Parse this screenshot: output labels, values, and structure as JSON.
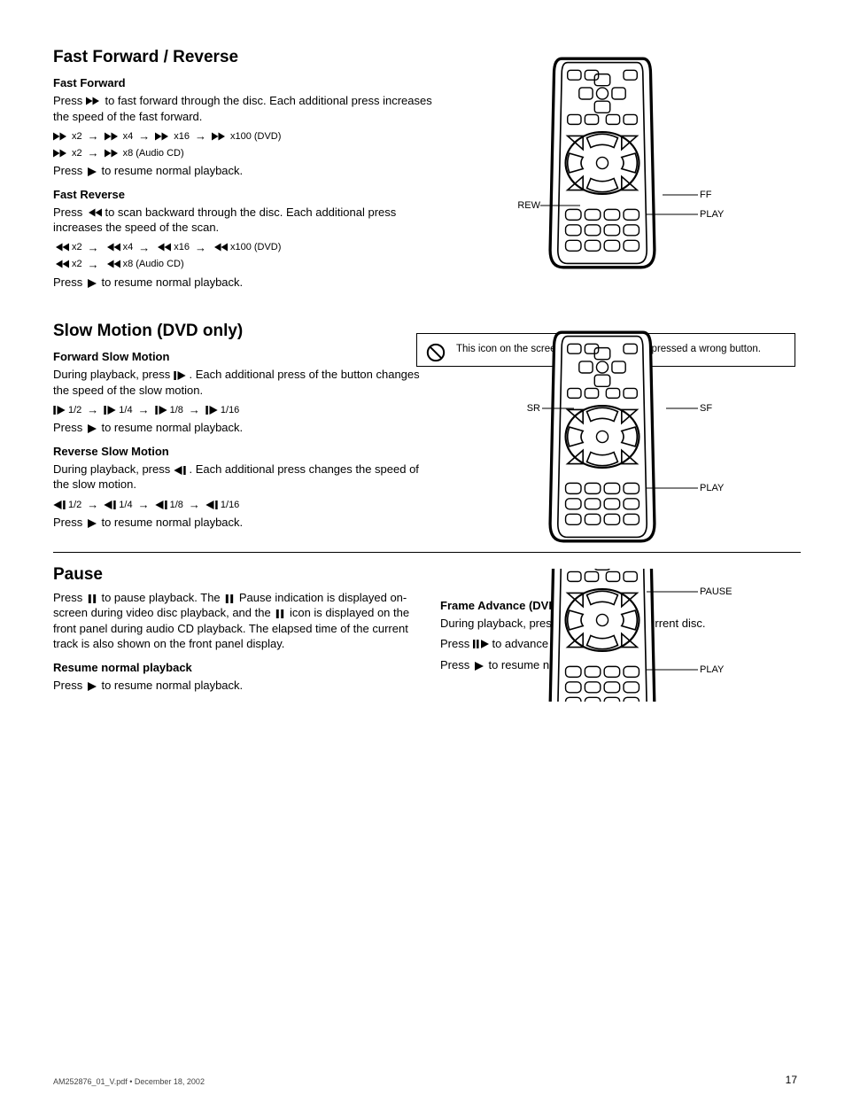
{
  "fast": {
    "heading": "Fast Forward / Reverse",
    "fwd_sub": "Fast Forward",
    "fwd_p1_a": "Press ",
    "fwd_p1_b": " to fast forward through the disc. Each additional press increases the speed of the fast forward.",
    "fwd_seq_labels": [
      "x2",
      "x4",
      "x16",
      "x100",
      "(DVD)",
      "x2",
      "x8",
      "(Audio CD)"
    ],
    "fwd_p2_a": "Press ",
    "fwd_p2_b": " to resume normal playback.",
    "rev_sub": "Fast Reverse",
    "rev_p1_a": "Press ",
    "rev_p1_b": " to scan backward through the disc. Each additional press increases the speed of the scan.",
    "rev_seq_labels": [
      "x2",
      "x4",
      "x16",
      "x100",
      "(DVD)",
      "x2",
      "x8",
      "(Audio CD)"
    ],
    "rev_p2_a": "Press ",
    "rev_p2_b": " to resume normal playback.",
    "captions": {
      "ff": "FF",
      "rew": "REW",
      "play": "PLAY"
    }
  },
  "slow": {
    "heading": "Slow Motion (DVD only)",
    "fwd_sub": "Forward Slow Motion",
    "fwd_p1_a": "During playback, press ",
    "fwd_p1_b": ". Each additional press of the button changes the speed of the slow motion.",
    "fwd_seq_labels": [
      "1/2",
      "1/4",
      "1/8",
      "1/16"
    ],
    "fwd_p2_a": "Press ",
    "fwd_p2_b": " to resume normal playback.",
    "rev_sub": "Reverse Slow Motion",
    "rev_p1_a": "During playback, press ",
    "rev_p1_b": ". Each additional press changes the speed of the slow motion.",
    "rev_seq_labels": [
      "1/2",
      "1/4",
      "1/8",
      "1/16"
    ],
    "rev_p2_a": "Press ",
    "rev_p2_b": " to resume normal playback.",
    "captions": {
      "sf": "SF",
      "sr": "SR",
      "play": "PLAY"
    }
  },
  "info_box": "This icon on the screen indicates you have pressed a wrong button.",
  "pause": {
    "heading": "Pause",
    "p1_a": "Press ",
    "p1_b": " to pause playback. The ",
    "p1_c": " Pause indication is displayed on-screen during video disc playback, and the ",
    "p1_d": " icon is displayed on the front panel during audio CD playback. The elapsed time of the current track is also shown on the front panel display.",
    "p2_sub": "Resume normal playback",
    "p2_a": "Press ",
    "p2_b": " to resume normal playback.",
    "frame_sub": "Frame Advance (DVD only)",
    "frame_p1_a": "During playback, press ",
    "frame_p1_b": " to pause the current disc.",
    "frame_p2_a": "Press ",
    "frame_p2_b": " to advance one frame at a time.",
    "frame_p3_a": "Press ",
    "frame_p3_b": " to resume normal disc play.",
    "captions": {
      "pause": "PAUSE",
      "play": "PLAY"
    }
  },
  "page_number": "17",
  "footer": "AM252876_01_V.pdf • December 18, 2002"
}
